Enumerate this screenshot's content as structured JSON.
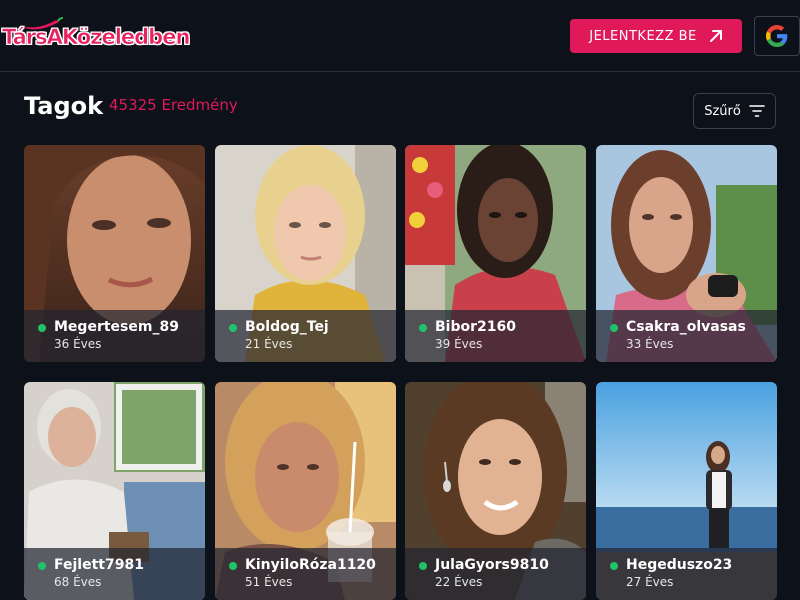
{
  "header": {
    "logo_text": "TársAKözeledben",
    "login_label": "JELENTKEZZ BE",
    "google_icon": "google-icon",
    "colors": {
      "accent": "#e0195a",
      "background": "#0d1119",
      "online": "#1fc46a"
    }
  },
  "page": {
    "title": "Tagok",
    "results": "45325 Eredmény",
    "filter_label": "Szűrő"
  },
  "members": [
    {
      "name": "Megertesem_89",
      "age": "36 Éves",
      "online": true
    },
    {
      "name": "Boldog_Tej",
      "age": "21 Éves",
      "online": true
    },
    {
      "name": "Bibor2160",
      "age": "39 Éves",
      "online": true
    },
    {
      "name": "Csakra_olvasas",
      "age": "33 Éves",
      "online": true
    },
    {
      "name": "Fejlett7981",
      "age": "68 Éves",
      "online": true
    },
    {
      "name": "KinyiloRóza1120",
      "age": "51 Éves",
      "online": true
    },
    {
      "name": "JulaGyors9810",
      "age": "22 Éves",
      "online": true
    },
    {
      "name": "Hegeduszo23",
      "age": "27 Éves",
      "online": true
    }
  ]
}
